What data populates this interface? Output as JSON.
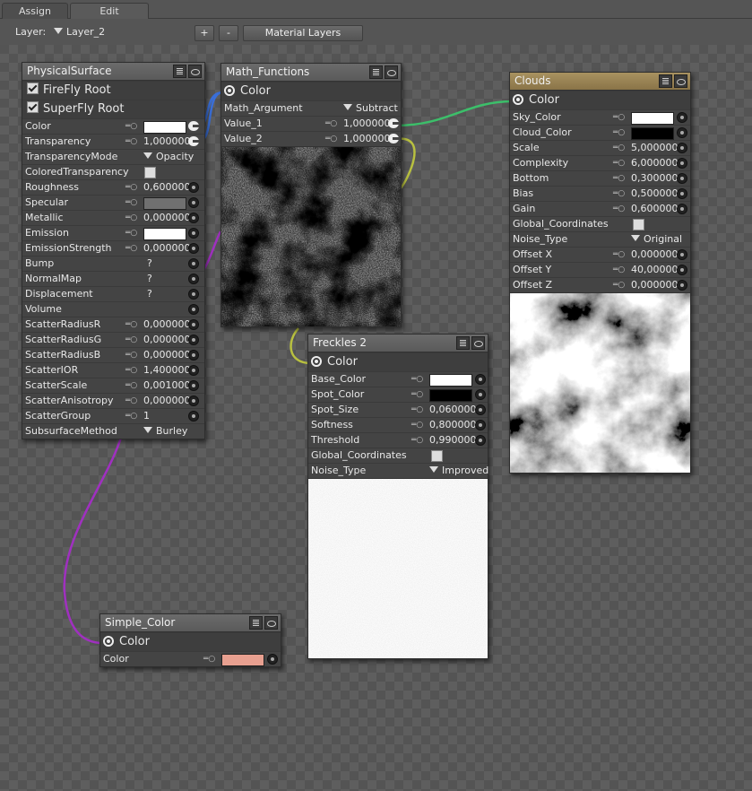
{
  "tabs": [
    "Assign",
    "Edit"
  ],
  "toolbar": {
    "layer_label": "Layer:",
    "layer_value": "Layer_2",
    "plus": "+",
    "minus": "-",
    "material_layers": "Material Layers"
  },
  "physical": {
    "title": "PhysicalSurface",
    "firefly": "FireFly Root",
    "superfly": "SuperFly Root",
    "rows": [
      {
        "label": "Color",
        "kind": "swatch",
        "color": "#ffffff",
        "out": true
      },
      {
        "label": "Transparency",
        "kind": "num",
        "value": "1,000000",
        "out": true
      },
      {
        "label": "TransparencyMode",
        "kind": "dropdown",
        "value": "Opacity"
      },
      {
        "label": "ColoredTransparency",
        "kind": "check"
      },
      {
        "label": "Roughness",
        "kind": "num",
        "value": "0,600000"
      },
      {
        "label": "Specular",
        "kind": "swatch",
        "color": "#707070"
      },
      {
        "label": "Metallic",
        "kind": "num",
        "value": "0,000000"
      },
      {
        "label": "Emission",
        "kind": "swatch",
        "color": "#ffffff"
      },
      {
        "label": "EmissionStrength",
        "kind": "num",
        "value": "0,000000"
      },
      {
        "label": "Bump",
        "kind": "q",
        "value": "?"
      },
      {
        "label": "NormalMap",
        "kind": "q",
        "value": "?"
      },
      {
        "label": "Displacement",
        "kind": "q",
        "value": "?"
      },
      {
        "label": "Volume",
        "kind": "empty"
      },
      {
        "label": "ScatterRadiusR",
        "kind": "num",
        "value": "0,000000"
      },
      {
        "label": "ScatterRadiusG",
        "kind": "num",
        "value": "0,000000"
      },
      {
        "label": "ScatterRadiusB",
        "kind": "num",
        "value": "0,000000"
      },
      {
        "label": "ScatterIOR",
        "kind": "num",
        "value": "1,400000"
      },
      {
        "label": "ScatterScale",
        "kind": "num",
        "value": "0,001000"
      },
      {
        "label": "ScatterAnisotropy",
        "kind": "num",
        "value": "0,000000"
      },
      {
        "label": "ScatterGroup",
        "kind": "num",
        "value": "1"
      },
      {
        "label": "SubsurfaceMethod",
        "kind": "dropdown",
        "value": "Burley"
      }
    ]
  },
  "math": {
    "title": "Math_Functions",
    "output": "Color",
    "rows": [
      {
        "label": "Math_Argument",
        "kind": "dropdown",
        "value": "Subtract"
      },
      {
        "label": "Value_1",
        "kind": "num",
        "value": "1,000000",
        "out": true
      },
      {
        "label": "Value_2",
        "kind": "num",
        "value": "1,000000",
        "out": true
      }
    ]
  },
  "clouds": {
    "title": "Clouds",
    "output": "Color",
    "rows": [
      {
        "label": "Sky_Color",
        "kind": "swatch",
        "color": "#ffffff"
      },
      {
        "label": "Cloud_Color",
        "kind": "swatch",
        "color": "#000000"
      },
      {
        "label": "Scale",
        "kind": "num",
        "value": "5,000000"
      },
      {
        "label": "Complexity",
        "kind": "num",
        "value": "6,000000"
      },
      {
        "label": "Bottom",
        "kind": "num",
        "value": "0,300000"
      },
      {
        "label": "Bias",
        "kind": "num",
        "value": "0,500000"
      },
      {
        "label": "Gain",
        "kind": "num",
        "value": "0,600000"
      },
      {
        "label": "Global_Coordinates",
        "kind": "check"
      },
      {
        "label": "Noise_Type",
        "kind": "dropdown",
        "value": "Original"
      },
      {
        "label": "Offset X",
        "kind": "num",
        "value": "0,000000"
      },
      {
        "label": "Offset Y",
        "kind": "num",
        "value": "40,000000"
      },
      {
        "label": "Offset Z",
        "kind": "num",
        "value": "0,000000"
      }
    ]
  },
  "freckles": {
    "title": "Freckles 2",
    "output": "Color",
    "rows": [
      {
        "label": "Base_Color",
        "kind": "swatch",
        "color": "#ffffff"
      },
      {
        "label": "Spot_Color",
        "kind": "swatch",
        "color": "#000000"
      },
      {
        "label": "Spot_Size",
        "kind": "num",
        "value": "0,060000"
      },
      {
        "label": "Softness",
        "kind": "num",
        "value": "0,800000"
      },
      {
        "label": "Threshold",
        "kind": "num",
        "value": "0,990000"
      },
      {
        "label": "Global_Coordinates",
        "kind": "check"
      },
      {
        "label": "Noise_Type",
        "kind": "dropdown",
        "value": "Improved"
      }
    ]
  },
  "simple": {
    "title": "Simple_Color",
    "output": "Color",
    "rows": [
      {
        "label": "Color",
        "kind": "swatch",
        "color": "#e8a090"
      }
    ]
  },
  "colors": {
    "wire_blue": "#3a6fd8",
    "wire_purple": "#a030c0",
    "wire_green": "#3cbf6a",
    "wire_yellow": "#b8c040",
    "clouds_header": "#a08a58"
  }
}
